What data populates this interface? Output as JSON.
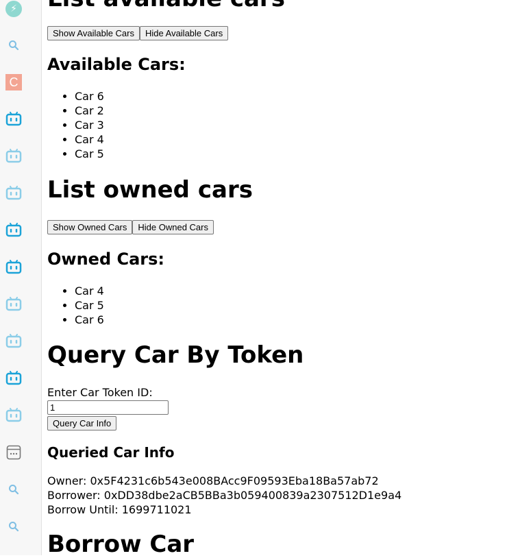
{
  "sidebar": {
    "icons": [
      "bolt-icon",
      "search-icon",
      "c-logo-icon",
      "tv-icon",
      "tv-icon",
      "tv-icon",
      "tv-icon",
      "tv-icon",
      "tv-icon",
      "tv-icon",
      "tv-icon",
      "tv-icon",
      "browser-icon",
      "search-icon",
      "search-icon"
    ],
    "c_logo_letter": "C",
    "colors": {
      "bolt": "#8fd8d0",
      "c_logo": "#f3a593",
      "tv_dark": "#1ba3d8",
      "tv_light": "#8bcde8",
      "search": "#7fbfe4"
    }
  },
  "available": {
    "section_title": "List available cars",
    "show_button": "Show Available Cars",
    "hide_button": "Hide Available Cars",
    "subtitle": "Available Cars:",
    "items": [
      "Car 6",
      "Car 2",
      "Car 3",
      "Car 4",
      "Car 5"
    ]
  },
  "owned": {
    "section_title": "List owned cars",
    "show_button": "Show Owned Cars",
    "hide_button": "Hide Owned Cars",
    "subtitle": "Owned Cars:",
    "items": [
      "Car 4",
      "Car 5",
      "Car 6"
    ]
  },
  "query": {
    "section_title": "Query Car By Token",
    "input_label": "Enter Car Token ID:",
    "input_value": "1",
    "button": "Query Car Info",
    "result_title": "Queried Car Info",
    "owner": "Owner: 0x5F4231c6b543e008BAcc9F09593Eba18Ba57ab72",
    "borrower": "Borrower: 0xDD38dbe2aCB5BBa3b059400839a2307512D1e9a4",
    "borrow_until": "Borrow Until: 1699711021"
  },
  "borrow": {
    "section_title": "Borrow Car"
  }
}
